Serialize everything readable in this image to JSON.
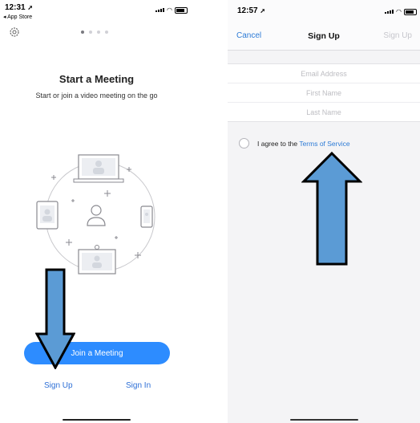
{
  "left_screen": {
    "status": {
      "time": "12:31",
      "back_app": "◂ App Store"
    },
    "icons": {
      "settings": "gear-icon",
      "location": "location-arrow-icon"
    },
    "page_dots": [
      true,
      false,
      false,
      false
    ],
    "title": "Start a Meeting",
    "subtitle": "Start or join a video meeting on the go",
    "join_button": "Join a Meeting",
    "sign_up": "Sign Up",
    "sign_in": "Sign In"
  },
  "right_screen": {
    "status": {
      "time": "12:57"
    },
    "nav": {
      "cancel": "Cancel",
      "title": "Sign Up",
      "action": "Sign Up"
    },
    "fields": {
      "email_placeholder": "Email Address",
      "first_name_placeholder": "First Name",
      "last_name_placeholder": "Last Name"
    },
    "terms": {
      "prefix": "I agree to the ",
      "link": "Terms of Service"
    }
  },
  "colors": {
    "zoom_blue": "#2d8cff",
    "link_blue": "#2d7bd6",
    "annotation_arrow": "#5b9bd5"
  }
}
